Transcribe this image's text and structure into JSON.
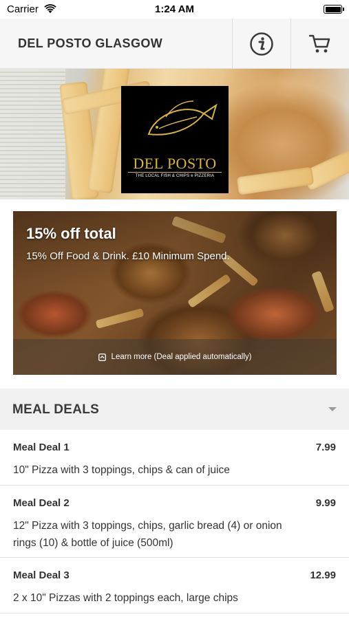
{
  "status_bar": {
    "carrier": "Carrier",
    "time": "1:24 AM"
  },
  "header": {
    "title": "DEL POSTO GLASGOW",
    "info_icon": "info-icon",
    "cart_icon": "cart-icon"
  },
  "hero": {
    "logo_name": "DEL POSTO",
    "logo_tagline": "THE LOCAL FISH & CHIPS e PIZZERIA"
  },
  "promo": {
    "title": "15% off total",
    "description": "15% Off Food & Drink. £10 Minimum Spend.",
    "learn_more": "Learn more (Deal applied automatically)"
  },
  "menu_section": {
    "title": "MEAL DEALS",
    "items": [
      {
        "name": "Meal Deal 1",
        "price": "7.99",
        "description": "10\" Pizza with 3 toppings, chips & can of juice"
      },
      {
        "name": "Meal Deal 2",
        "price": "9.99",
        "description": "12\" Pizza with 3 toppings, chips, garlic bread (4) or onion rings (10) & bottle of juice (500ml)"
      },
      {
        "name": "Meal Deal 3",
        "price": "12.99",
        "description": "2 x 10\" Pizzas with 2 toppings each, large chips"
      }
    ]
  },
  "colors": {
    "header_bg": "#f6f6f6",
    "section_bg": "#f0f0f0",
    "logo_gold": "#d9b43a",
    "text": "#333333"
  }
}
